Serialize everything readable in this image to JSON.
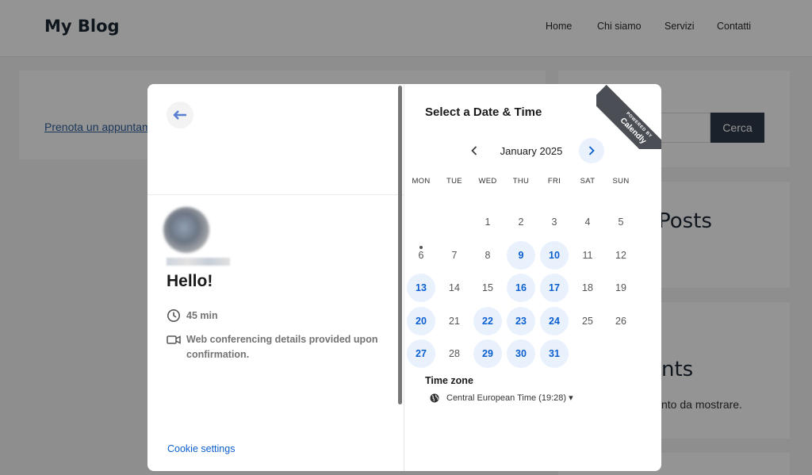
{
  "site": {
    "title": "My Blog",
    "nav": [
      "Home",
      "Chi siamo",
      "Servizi",
      "Contatti"
    ],
    "book_link": "Prenota un appuntam",
    "search_button": "Cerca",
    "recent_posts_heading": "Posts",
    "comments_heading": "nts",
    "comments_empty": "nto da mostrare."
  },
  "modal": {
    "event_title": "Hello!",
    "duration": "45 min",
    "location": "Web conferencing details provided upon confirmation.",
    "cookie_settings": "Cookie settings",
    "scheduler_title": "Select a Date & Time",
    "month": "January 2025",
    "weekdays": [
      "MON",
      "TUE",
      "WED",
      "THU",
      "FRI",
      "SAT",
      "SUN"
    ],
    "weeks": [
      [
        "",
        "",
        "1",
        "2",
        "3",
        "4",
        "5"
      ],
      [
        "6",
        "7",
        "8",
        "9",
        "10",
        "11",
        "12"
      ],
      [
        "13",
        "14",
        "15",
        "16",
        "17",
        "18",
        "19"
      ],
      [
        "20",
        "21",
        "22",
        "23",
        "24",
        "25",
        "26"
      ],
      [
        "27",
        "28",
        "29",
        "30",
        "31",
        "",
        ""
      ]
    ],
    "available_days": [
      "9",
      "10",
      "13",
      "16",
      "17",
      "20",
      "22",
      "23",
      "24",
      "27",
      "29",
      "30",
      "31"
    ],
    "today": "6",
    "timezone_label": "Time zone",
    "timezone_value": "Central European Time (19:28) ▾",
    "ribbon_small": "POWERED BY",
    "ribbon_brand": "Calendly",
    "accent_color": "#0b5fcf",
    "available_bg_color": "#e9f1fd"
  }
}
